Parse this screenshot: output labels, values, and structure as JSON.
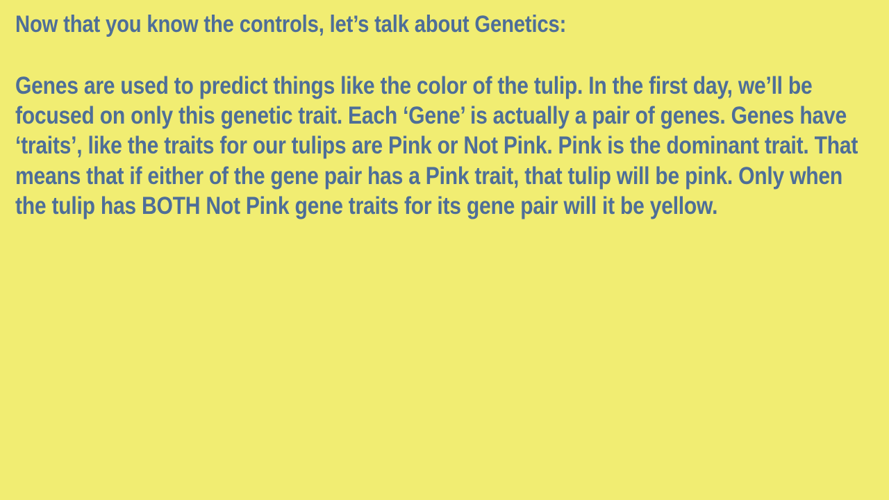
{
  "slide": {
    "background_color": "#f1ed72",
    "text_color": "#4e6e98",
    "heading": "Now that you know the controls, let’s talk about Genetics:",
    "body": "Genes are used to predict things like the color of the tulip. In the first day, we’ll be focused on only this genetic trait. Each ‘Gene’ is actually a pair of genes. Genes have ‘traits’, like the traits for our tulips are Pink or Not Pink. Pink is the dominant trait. That means that if either of the gene pair has a Pink trait, that tulip will be pink. Only when the tulip has BOTH Not Pink gene traits for its gene pair will it be yellow."
  }
}
